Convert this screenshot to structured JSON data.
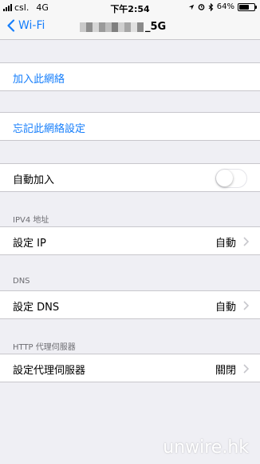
{
  "status_bar": {
    "carrier": "csl.",
    "network": "4G",
    "time": "下午2:54",
    "battery": "64%",
    "battery_level": 0.64
  },
  "nav": {
    "back_label": "Wi-Fi",
    "title_suffix": "_5G"
  },
  "actions": {
    "join": "加入此網絡",
    "forget": "忘記此網絡設定"
  },
  "auto_join": {
    "label": "自動加入",
    "enabled": false
  },
  "ipv4": {
    "header": "IPV4 地址",
    "label": "設定 IP",
    "value": "自動"
  },
  "dns": {
    "header": "DNS",
    "label": "設定 DNS",
    "value": "自動"
  },
  "proxy": {
    "header": "HTTP 代理伺服器",
    "label": "設定代理伺服器",
    "value": "關閉"
  },
  "watermark": "unwire.hk",
  "colors": {
    "accent": "#157efb",
    "background": "#efeff4",
    "separator": "#c8c7cc",
    "secondary_text": "#6d6d72"
  }
}
